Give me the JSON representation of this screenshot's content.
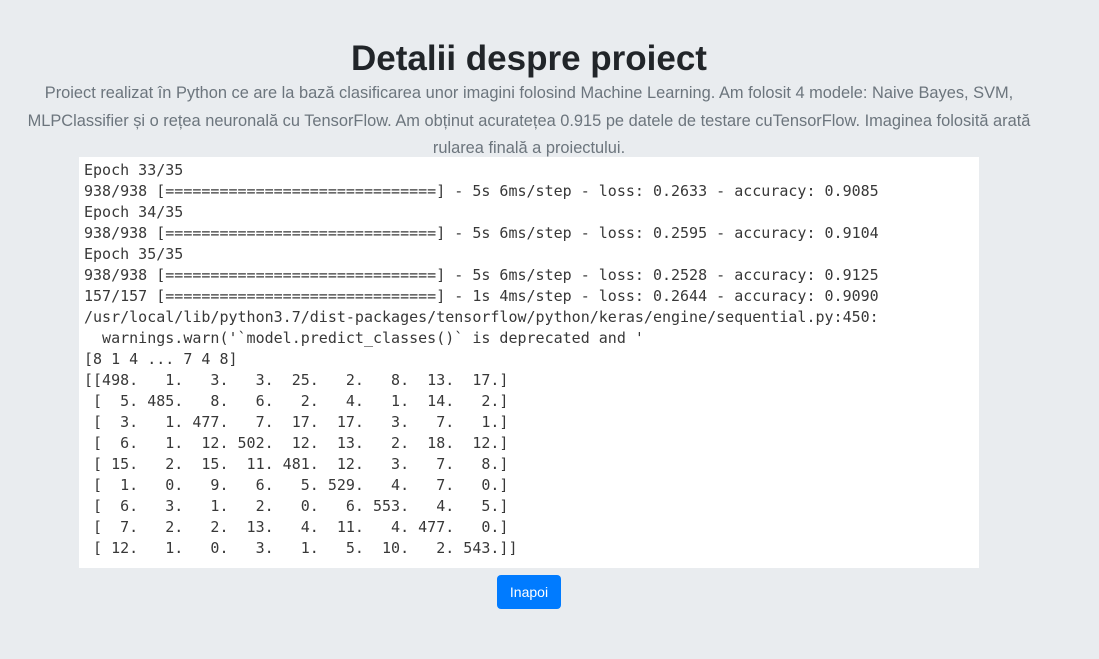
{
  "page": {
    "title": "Detalii despre proiect",
    "description": "Proiect realizat în Python ce are la bază clasificarea unor imagini folosind Machine Learning. Am folosit 4 modele: Naive Bayes, SVM, MLPClassifier și o rețea neuronală cu TensorFlow. Am obținut acuratețea 0.915 pe datele de testare cuTensorFlow. Imaginea folosită arată rularea finală a proiectului.",
    "back_button": "Inapoi"
  },
  "colors": {
    "background": "#e9ecef",
    "title": "#212529",
    "description": "#6c757d",
    "button": "#007bff",
    "button_text": "#ffffff"
  },
  "console_output": {
    "lines": [
      "Epoch 33/35",
      "938/938 [==============================] - 5s 6ms/step - loss: 0.2633 - accuracy: 0.9085",
      "Epoch 34/35",
      "938/938 [==============================] - 5s 6ms/step - loss: 0.2595 - accuracy: 0.9104",
      "Epoch 35/35",
      "938/938 [==============================] - 5s 6ms/step - loss: 0.2528 - accuracy: 0.9125",
      "157/157 [==============================] - 1s 4ms/step - loss: 0.2644 - accuracy: 0.9090",
      "/usr/local/lib/python3.7/dist-packages/tensorflow/python/keras/engine/sequential.py:450:",
      "  warnings.warn('`model.predict_classes()` is deprecated and '",
      "[8 1 4 ... 7 4 8]",
      "[[498.   1.   3.   3.  25.   2.   8.  13.  17.]",
      " [  5. 485.   8.   6.   2.   4.   1.  14.   2.]",
      " [  3.   1. 477.   7.  17.  17.   3.   7.   1.]",
      " [  6.   1.  12. 502.  12.  13.   2.  18.  12.]",
      " [ 15.   2.  15.  11. 481.  12.   3.   7.   8.]",
      " [  1.   0.   9.   6.   5. 529.   4.   7.   0.]",
      " [  6.   3.   1.   2.   0.   6. 553.   4.   5.]",
      " [  7.   2.   2.  13.   4.  11.   4. 477.   0.]",
      " [ 12.   1.   0.   3.   1.   5.  10.   2. 543.]]"
    ]
  }
}
